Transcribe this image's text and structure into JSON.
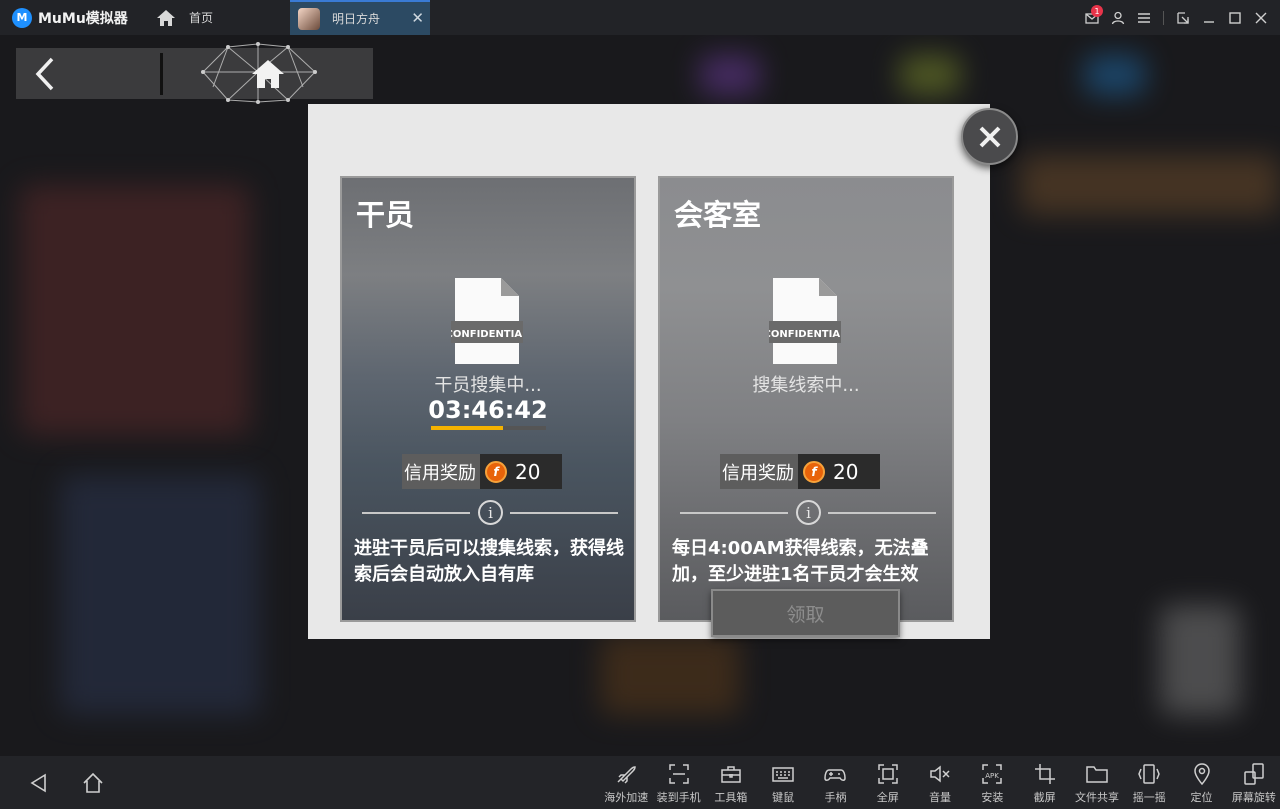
{
  "app": {
    "name": "MuMu模拟器"
  },
  "tabs": [
    {
      "label": "首页",
      "icon": "home-icon"
    },
    {
      "label": "明日方舟",
      "icon": "game-avatar-icon",
      "active": true
    }
  ],
  "window_controls": {
    "mail_badge": "1"
  },
  "modal": {
    "cards": [
      {
        "title": "干员",
        "doc_stamp": "CONFIDENTIAL",
        "status": "干员搜集中...",
        "timer": "03:46:42",
        "progress": 0.63,
        "credit_label": "信用奖励",
        "credit_value": "20",
        "description": "进驻干员后可以搜集线索，获得线索后会自动放入自有库"
      },
      {
        "title": "会客室",
        "doc_stamp": "CONFIDENTIAL",
        "status": "搜集线索中...",
        "credit_label": "信用奖励",
        "credit_value": "20",
        "description": "每日4:00AM获得线索，无法叠加，至少进驻1名干员才会生效",
        "button": "领取"
      }
    ]
  },
  "toolbar": [
    {
      "label": "海外加速",
      "icon": "rocket-icon"
    },
    {
      "label": "装到手机",
      "icon": "scan-icon"
    },
    {
      "label": "工具箱",
      "icon": "toolbox-icon"
    },
    {
      "label": "键鼠",
      "icon": "keyboard-icon"
    },
    {
      "label": "手柄",
      "icon": "gamepad-icon"
    },
    {
      "label": "全屏",
      "icon": "fullscreen-icon"
    },
    {
      "label": "音量",
      "icon": "volume-mute-icon"
    },
    {
      "label": "安装",
      "icon": "apk-icon"
    },
    {
      "label": "截屏",
      "icon": "crop-icon"
    },
    {
      "label": "文件共享",
      "icon": "folder-icon"
    },
    {
      "label": "摇一摇",
      "icon": "shake-icon"
    },
    {
      "label": "定位",
      "icon": "location-icon"
    },
    {
      "label": "屏幕旋转",
      "icon": "rotate-icon"
    }
  ],
  "colors": {
    "accent": "#f5b200",
    "coin": "#e8630a",
    "tab_active": "#2c4a63"
  }
}
